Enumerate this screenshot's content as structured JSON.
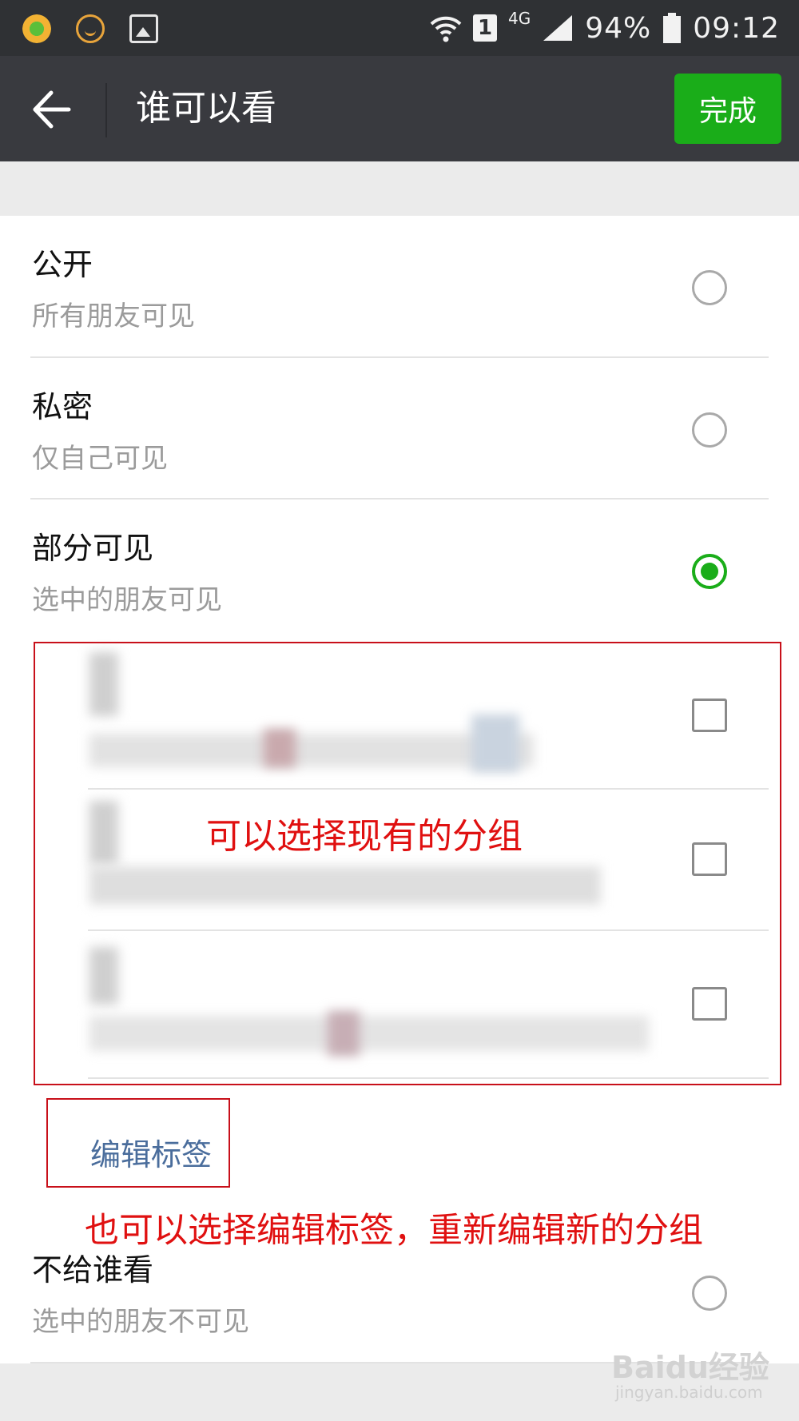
{
  "status_bar": {
    "network": "4G",
    "sim": "1",
    "battery": "94%",
    "time": "09:12"
  },
  "header": {
    "title": "谁可以看",
    "done_label": "完成"
  },
  "options": [
    {
      "title": "公开",
      "subtitle": "所有朋友可见",
      "selected": false
    },
    {
      "title": "私密",
      "subtitle": "仅自己可见",
      "selected": false
    },
    {
      "title": "部分可见",
      "subtitle": "选中的朋友可见",
      "selected": true
    },
    {
      "title": "不给谁看",
      "subtitle": "选中的朋友不可见",
      "selected": false
    }
  ],
  "groups": [
    {
      "checked": false
    },
    {
      "checked": false
    },
    {
      "checked": false
    }
  ],
  "edit_tags_label": "编辑标签",
  "annotations": {
    "groups_note": "可以选择现有的分组",
    "edit_note": "也可以选择编辑标签，重新编辑新的分组"
  },
  "watermark": {
    "brand": "Baidu经验",
    "url": "jingyan.baidu.com"
  },
  "colors": {
    "accent_green": "#1aad19",
    "header_bg": "#393a3f",
    "annotation_red": "#e01010",
    "link_blue": "#4a6d9c"
  }
}
